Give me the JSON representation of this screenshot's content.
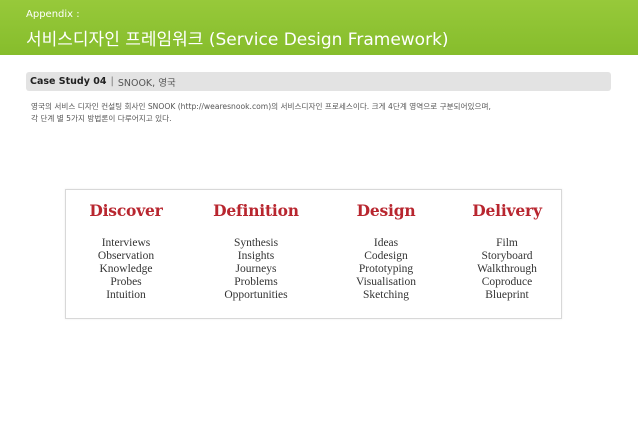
{
  "header": {
    "kicker": "Appendix :",
    "title": "서비스디자인 프레임워크 (Service Design Framework)"
  },
  "case_bar": {
    "label": "Case Study 04",
    "separator": "|",
    "subtitle": "SNOOK, 영국"
  },
  "description": {
    "line1": "영국의 서비스 디자인 컨설팅 회사인 SNOOK (http://wearesnook.com)의 서비스디자인 프로세스이다. 크게 4단계 영역으로 구분되어있으며,",
    "line2": "각 단계 별 5가지 방법론이 다루어지고 있다."
  },
  "framework": {
    "columns": [
      {
        "heading": "Discover",
        "items": [
          "Interviews",
          "Observation",
          "Knowledge",
          "Probes",
          "Intuition"
        ]
      },
      {
        "heading": "Definition",
        "items": [
          "Synthesis",
          "Insights",
          "Journeys",
          "Problems",
          "Opportunities"
        ]
      },
      {
        "heading": "Design",
        "items": [
          "Ideas",
          "Codesign",
          "Prototyping",
          "Visualisation",
          "Sketching"
        ]
      },
      {
        "heading": "Delivery",
        "items": [
          "Film",
          "Storyboard",
          "Walkthrough",
          "Coproduce",
          "Blueprint"
        ]
      }
    ]
  },
  "colors": {
    "header_green": "#8cc232",
    "heading_red": "#b8262f"
  }
}
